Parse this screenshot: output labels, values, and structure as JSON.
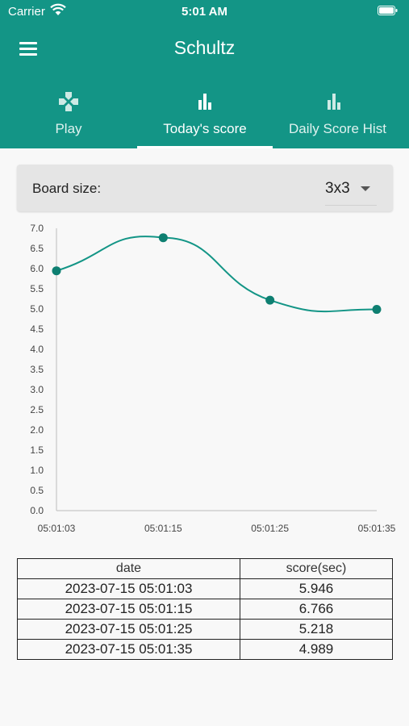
{
  "status_bar": {
    "carrier": "Carrier",
    "time": "5:01 AM"
  },
  "header": {
    "title": "Schultz"
  },
  "tabs": [
    {
      "label": "Play",
      "icon": "gamepad-icon",
      "active": false
    },
    {
      "label": "Today's score",
      "icon": "bar-chart-icon",
      "active": true
    },
    {
      "label": "Daily Score Hist",
      "icon": "bar-chart-icon",
      "active": false
    }
  ],
  "board": {
    "label": "Board size:",
    "value": "3x3"
  },
  "colors": {
    "accent": "#139586",
    "point": "#0e7f71"
  },
  "chart_data": {
    "type": "line",
    "x": [
      "05:01:03",
      "05:01:15",
      "05:01:25",
      "05:01:35"
    ],
    "series": [
      {
        "values": [
          5.946,
          6.766,
          5.218,
          4.989
        ]
      }
    ],
    "yticks": [
      "0.0",
      "0.5",
      "1.0",
      "1.5",
      "2.0",
      "2.5",
      "3.0",
      "3.5",
      "4.0",
      "4.5",
      "5.0",
      "5.5",
      "6.0",
      "6.5",
      "7.0"
    ],
    "ylim": [
      0,
      7
    ],
    "grid": false
  },
  "table": {
    "headers": [
      "date",
      "score(sec)"
    ],
    "rows": [
      [
        "2023-07-15 05:01:03",
        "5.946"
      ],
      [
        "2023-07-15 05:01:15",
        "6.766"
      ],
      [
        "2023-07-15 05:01:25",
        "5.218"
      ],
      [
        "2023-07-15 05:01:35",
        "4.989"
      ]
    ]
  }
}
